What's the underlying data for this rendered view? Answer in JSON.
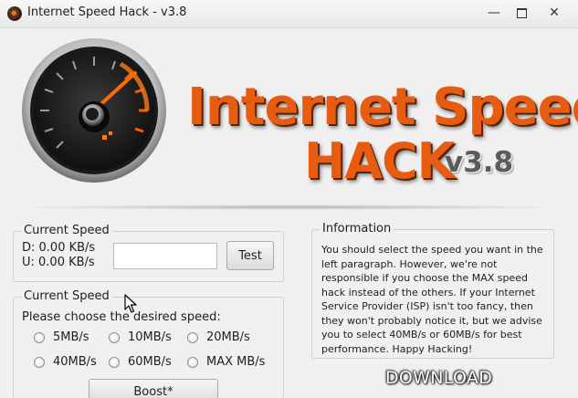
{
  "window": {
    "title": "Internet Speed Hack - v3.8",
    "controls": {
      "minimize": "—",
      "close": "✕"
    }
  },
  "banner": {
    "line1": "Internet Speed",
    "line2": "HACK",
    "version": "v3.8",
    "colors": {
      "brand": "#e85c12",
      "version": "#5b5b5b"
    }
  },
  "current_speed": {
    "title": "Current Speed",
    "download": "D: 0.00 KB/s",
    "upload": "U: 0.00 KB/s",
    "speed_field_value": "",
    "test_button": "Test"
  },
  "speed_select": {
    "title": "Current Speed",
    "prompt": "Please choose the desired speed:",
    "options": [
      "5MB/s",
      "10MB/s",
      "20MB/s",
      "40MB/s",
      "60MB/s",
      "MAX MB/s"
    ],
    "selected": null,
    "boost_button": "Boost*"
  },
  "information": {
    "title": "Information",
    "text": "You should select the speed you want in the left paragraph. However, we're not responsible if you choose the MAX speed hack instead of the others. If your Internet Service Provider (ISP) isn't too fancy, then they won't probably notice it, but we advise you to select 40MB/s or 60MB/s for best performance. Happy Hacking!"
  },
  "overlay": {
    "download_label": "DOWNLOAD"
  },
  "icons": [
    "app-icon",
    "minimize-icon",
    "maximize-icon",
    "close-icon",
    "speedometer-graphic",
    "mouse-cursor-icon"
  ]
}
